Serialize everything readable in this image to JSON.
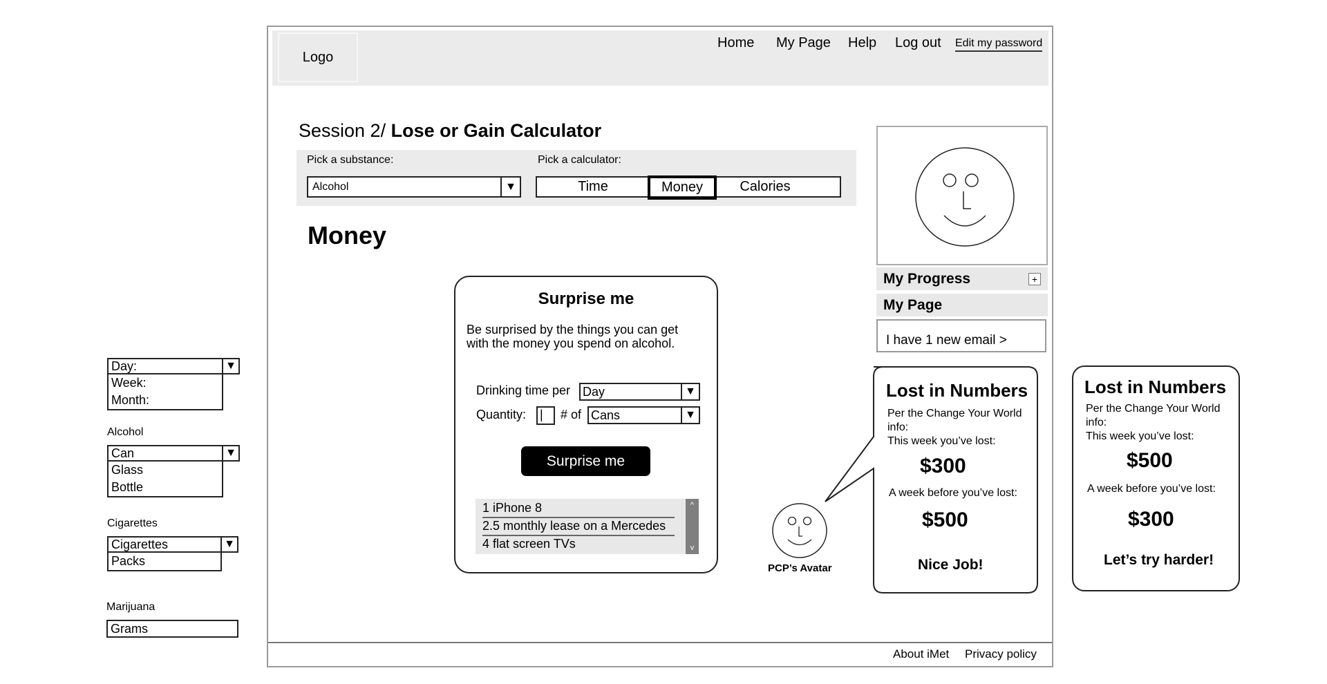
{
  "header": {
    "logo": "Logo",
    "nav": [
      "Home",
      "My Page",
      "Help",
      "Log out"
    ],
    "edit_password": "Edit my password"
  },
  "page": {
    "session": "Session 2/",
    "title": " Lose or Gain Calculator",
    "substance_label": "Pick a substance:",
    "substance_value": "Alcohol",
    "calculator_label": "Pick a calculator:",
    "calculators": [
      "Time",
      "Money",
      "Calories"
    ],
    "active_calculator": "Money",
    "section_title": "Money"
  },
  "surprise": {
    "title": "Surprise me",
    "description": "Be surprised by the things you can get with the money you spend on alcohol.",
    "drinking_label": "Drinking time per",
    "drinking_value": "Day",
    "quantity_label": "Quantity:",
    "quantity_value": "|",
    "of_label": "# of",
    "unit_value": "Cans",
    "button": "Surprise me",
    "results": [
      "1 iPhone 8",
      "2.5 monthly lease on a Mercedes",
      "4 flat screen TVs"
    ],
    "scroll_up": "^",
    "scroll_down": "v"
  },
  "sidebar": {
    "progress": "My Progress",
    "progress_toggle": "+",
    "my_page": "My Page",
    "email": "I have 1 new email >"
  },
  "avatar_label": "PCP’s Avatar",
  "lost_cards": [
    {
      "title": "Lost in Numbers",
      "intro": "Per the Change Your World info:",
      "this_week_label": "This week you’ve lost:",
      "this_week": "$300",
      "week_before_label": "A week before you’ve lost:",
      "week_before": "$500",
      "message": "Nice Job!"
    },
    {
      "title": "Lost in Numbers",
      "intro": "Per the Change Your World info:",
      "this_week_label": "This week you’ve lost:",
      "this_week": "$500",
      "week_before_label": "A week before you’ve lost:",
      "week_before": "$300",
      "message": "Let’s try harder!"
    }
  ],
  "footer": {
    "about": "About iMet",
    "privacy": "Privacy policy"
  },
  "annotations": {
    "period": {
      "selected": "Day:",
      "options": [
        "Week:",
        "Month:"
      ]
    },
    "alcohol": {
      "label": "Alcohol",
      "selected": "Can",
      "options": [
        "Glass",
        "Bottle"
      ]
    },
    "cigarettes": {
      "label": "Cigarettes",
      "selected": "Cigarettes",
      "options": [
        "Packs"
      ]
    },
    "marijuana": {
      "label": "Marijuana",
      "value": "Grams"
    }
  },
  "icons": {
    "dropdown": "▼"
  }
}
